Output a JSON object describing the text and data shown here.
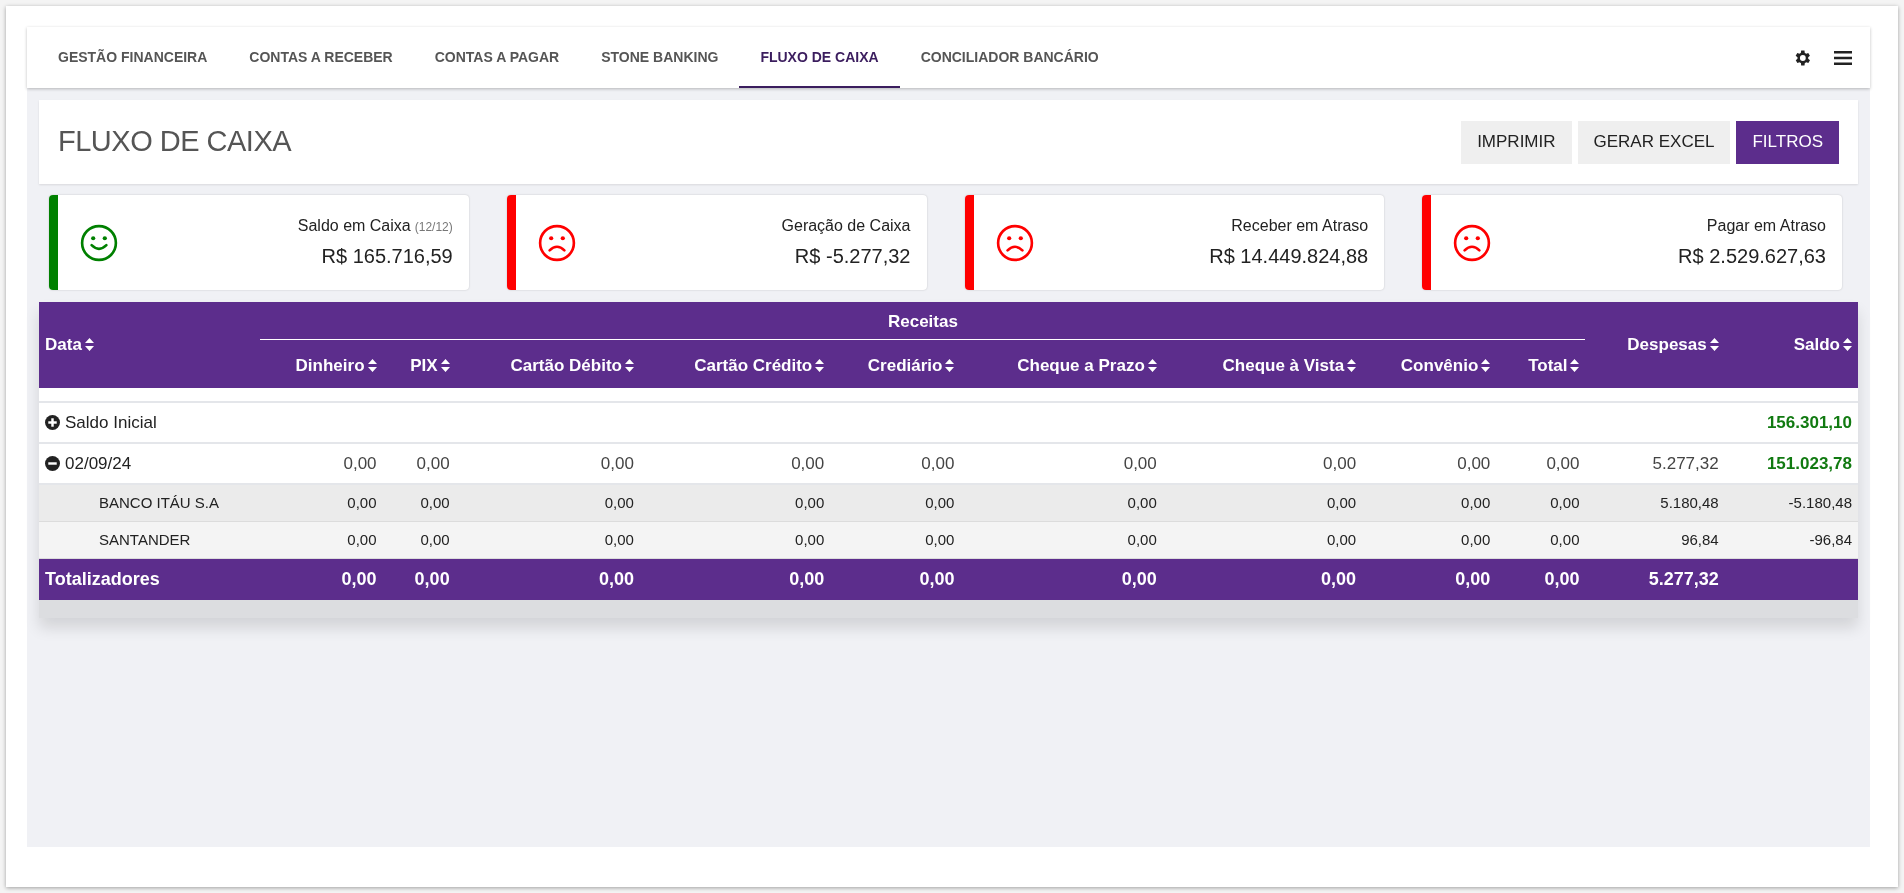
{
  "nav": {
    "tabs": [
      {
        "label": "GESTÃO FINANCEIRA",
        "selected": false
      },
      {
        "label": "CONTAS A RECEBER",
        "selected": false
      },
      {
        "label": "CONTAS A PAGAR",
        "selected": false
      },
      {
        "label": "STONE BANKING",
        "selected": false
      },
      {
        "label": "FLUXO DE CAIXA",
        "selected": true
      },
      {
        "label": "CONCILIADOR BANCÁRIO",
        "selected": false
      }
    ]
  },
  "header": {
    "title": "FLUXO DE CAIXA",
    "buttons": [
      {
        "label": "IMPRIMIR",
        "kind": "plain"
      },
      {
        "label": "GERAR EXCEL",
        "kind": "plain"
      },
      {
        "label": "FILTROS",
        "kind": "primary"
      }
    ]
  },
  "cards": [
    {
      "label": "Saldo em Caixa",
      "note": "(12/12)",
      "value": "R$ 165.716,59",
      "kind": "happy",
      "color": "#008000"
    },
    {
      "label": "Geração de Caixa",
      "value": "R$ -5.277,32",
      "kind": "sad",
      "color": "#ff0000"
    },
    {
      "label": "Receber em Atraso",
      "value": "R$ 14.449.824,88",
      "kind": "sad",
      "color": "#ff0000"
    },
    {
      "label": "Pagar em Atraso",
      "value": "R$ 2.529.627,63",
      "kind": "sad",
      "color": "#ff0000"
    }
  ],
  "table": {
    "date_column": "Data",
    "group": "Receitas",
    "group_columns": [
      "Dinheiro",
      "PIX",
      "Cartão Débito",
      "Cartão Crédito",
      "Crediário",
      "Cheque a Prazo",
      "Cheque à Vista",
      "Convênio",
      "Total"
    ],
    "after_columns": [
      "Despesas",
      "Saldo"
    ],
    "rows": [
      {
        "kind": "initial",
        "expanded": false,
        "label": "Saldo Inicial",
        "saldo": "156.301,10"
      },
      {
        "kind": "date",
        "expanded": true,
        "label": "02/09/24",
        "values": [
          "0,00",
          "0,00",
          "0,00",
          "0,00",
          "0,00",
          "0,00",
          "0,00",
          "0,00",
          "0,00",
          "5.277,32",
          "151.023,78"
        ],
        "children": [
          {
            "label": "BANCO ITÁU S.A",
            "values": [
              "0,00",
              "0,00",
              "0,00",
              "0,00",
              "0,00",
              "0,00",
              "0,00",
              "0,00",
              "0,00",
              "5.180,48",
              "-5.180,48"
            ]
          },
          {
            "label": "SANTANDER",
            "values": [
              "0,00",
              "0,00",
              "0,00",
              "0,00",
              "0,00",
              "0,00",
              "0,00",
              "0,00",
              "0,00",
              "96,84",
              "-96,84"
            ]
          }
        ]
      }
    ],
    "totals": {
      "label": "Totalizadores",
      "values": [
        "0,00",
        "0,00",
        "0,00",
        "0,00",
        "0,00",
        "0,00",
        "0,00",
        "0,00",
        "0,00",
        "5.277,32"
      ]
    }
  }
}
